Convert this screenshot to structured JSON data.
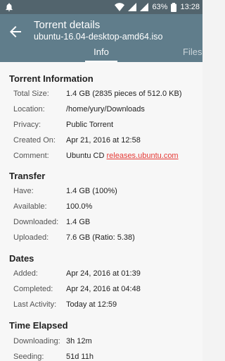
{
  "status_bar": {
    "battery": "63%",
    "time": "13:28",
    "icons": [
      "notification-bell-icon",
      "wifi-icon",
      "signal-icon",
      "signal-icon",
      "battery-icon"
    ]
  },
  "app_bar": {
    "back_icon": "back-arrow-icon",
    "title": "Torrent details",
    "subtitle": "ubuntu-16.04-desktop-amd64.iso"
  },
  "tabs": [
    {
      "label": "Info",
      "selected": true
    },
    {
      "label": "Files",
      "selected": false
    }
  ],
  "sections": {
    "torrent_info": {
      "title": "Torrent Information",
      "rows": [
        {
          "label": "Total Size:",
          "value": "1.4 GB (2835 pieces of 512.0 KB)"
        },
        {
          "label": "Location:",
          "value": "/home/yury/Downloads"
        },
        {
          "label": "Privacy:",
          "value": "Public Torrent"
        },
        {
          "label": "Created On:",
          "value": "Apr 21, 2016 at 12:58"
        },
        {
          "label": "Comment:",
          "value": "Ubuntu CD ",
          "link": "releases.ubuntu.com"
        }
      ]
    },
    "transfer": {
      "title": "Transfer",
      "rows": [
        {
          "label": "Have:",
          "value": "1.4 GB (100%)"
        },
        {
          "label": "Available:",
          "value": "100.0%"
        },
        {
          "label": "Downloaded:",
          "value": "1.4 GB"
        },
        {
          "label": "Uploaded:",
          "value": "7.6 GB (Ratio: 5.38)"
        }
      ]
    },
    "dates": {
      "title": "Dates",
      "rows": [
        {
          "label": "Added:",
          "value": "Apr 24, 2016 at 01:39"
        },
        {
          "label": "Completed:",
          "value": "Apr 24, 2016 at 04:48"
        },
        {
          "label": "Last Activity:",
          "value": "Today at 12:59"
        }
      ]
    },
    "time_elapsed": {
      "title": "Time Elapsed",
      "rows": [
        {
          "label": "Downloading:",
          "value": "3h 12m"
        },
        {
          "label": "Seeding:",
          "value": "51d 11h"
        }
      ]
    }
  },
  "colors": {
    "status_bar": "#52646d",
    "app_bar": "#607d8b",
    "link": "#e53935"
  }
}
